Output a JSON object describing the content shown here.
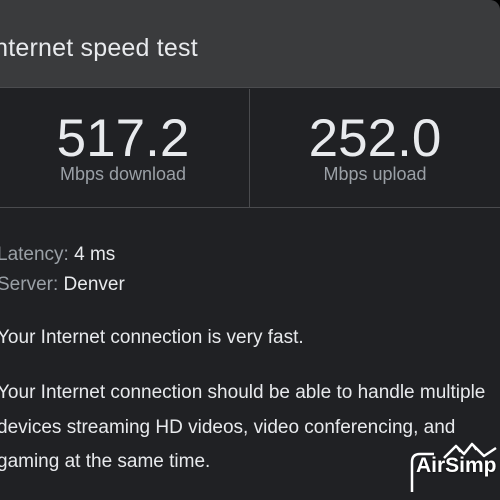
{
  "header": {
    "title": "Internet speed test"
  },
  "download": {
    "value": "517.2",
    "label": "Mbps download"
  },
  "upload": {
    "value": "252.0",
    "label": "Mbps upload"
  },
  "details": {
    "latency_label": "Latency: ",
    "latency_value": "4 ms",
    "server_label": "Server: ",
    "server_value": "Denver"
  },
  "summary": "Your Internet connection is very fast.",
  "description": "Your Internet connection should be able to handle multiple devices streaming HD videos, video conferencing, and gaming at the same time.",
  "watermark": {
    "text": "AirSimp",
    "icon": "mountain-icon"
  },
  "colors": {
    "background": "#202124",
    "header": "#3a3b3d",
    "text": "#e8eaed",
    "muted": "#9aa0a6"
  }
}
